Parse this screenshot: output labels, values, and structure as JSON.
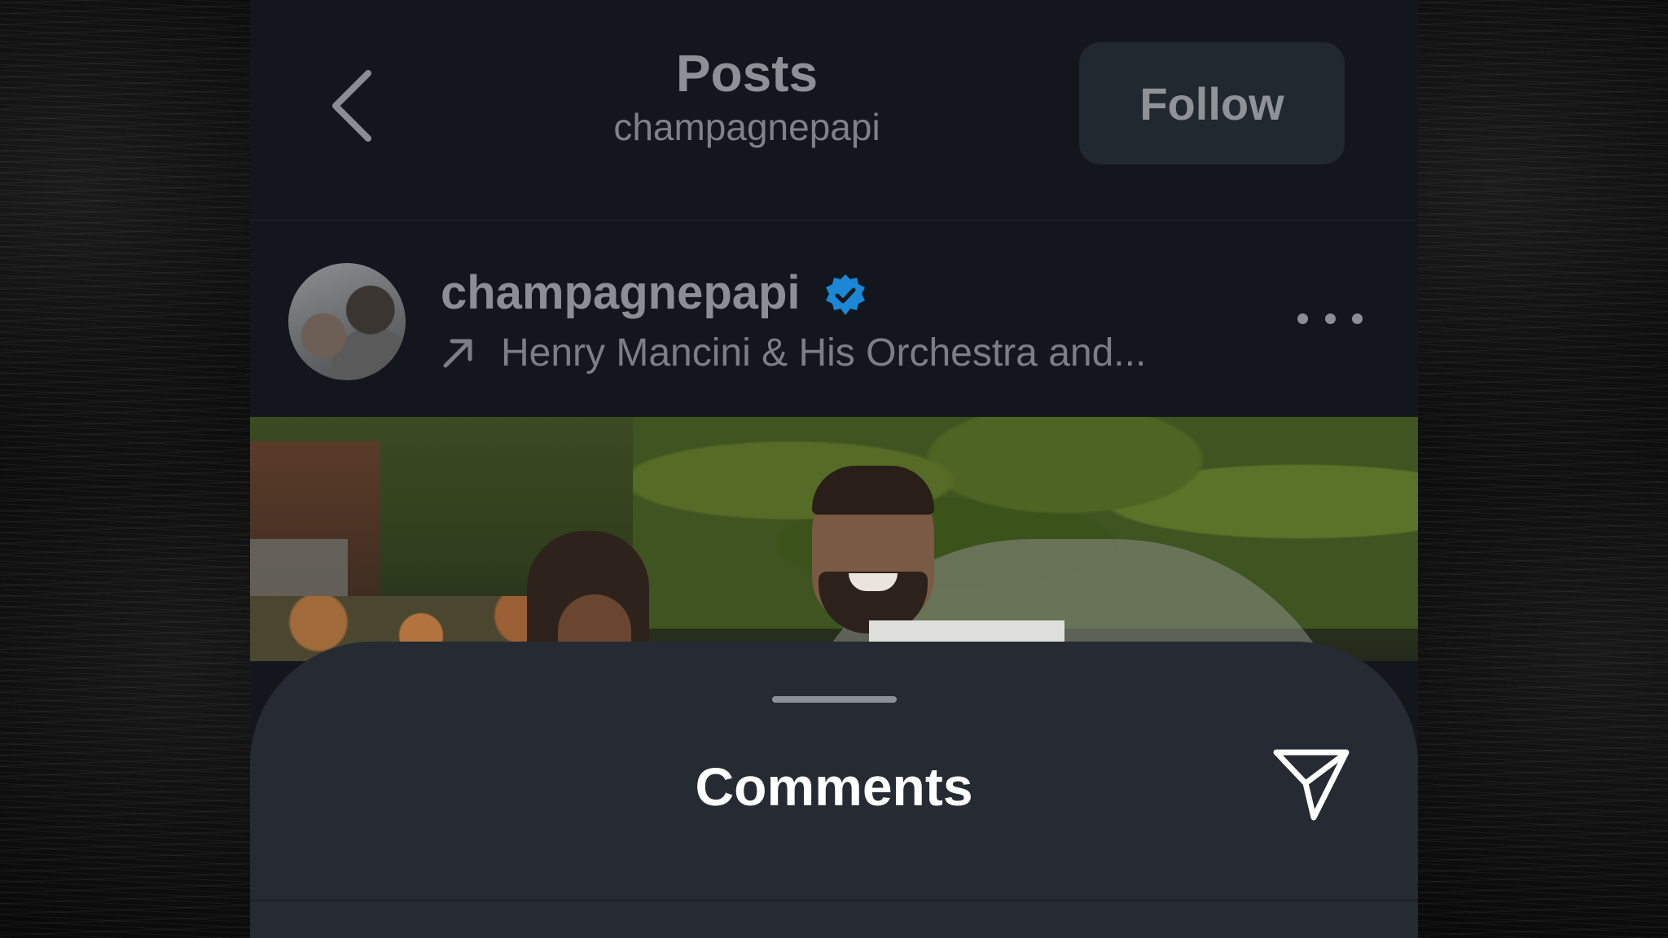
{
  "header": {
    "back_icon": "chevron-left-icon",
    "title": "Posts",
    "subtitle": "champagnepapi",
    "follow_label": "Follow"
  },
  "post": {
    "username": "champagnepapi",
    "verified_icon": "verified-badge-icon",
    "music_icon": "arrow-up-right-icon",
    "music_text": "Henry Mancini & His Orchestra and...",
    "more_icon": "more-horizontal-icon"
  },
  "sheet": {
    "title": "Comments",
    "share_icon": "send-icon"
  },
  "colors": {
    "page_background": "#13171d",
    "sheet_background": "#262a32",
    "follow_button_background": "#222830",
    "verified_badge": "#1c87d6",
    "muted_text": "#8b8f94",
    "sheet_title_text": "#ffffff"
  }
}
